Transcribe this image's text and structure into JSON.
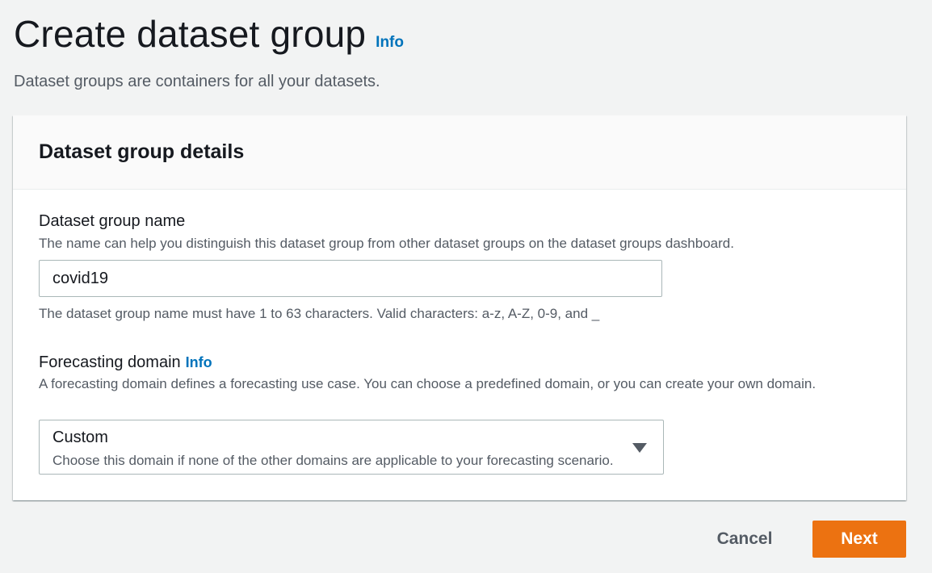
{
  "header": {
    "title": "Create dataset group",
    "info_label": "Info",
    "description": "Dataset groups are containers for all your datasets."
  },
  "panel": {
    "title": "Dataset group details",
    "name_field": {
      "label": "Dataset group name",
      "description": "The name can help you distinguish this dataset group from other dataset groups on the dataset groups dashboard.",
      "value": "covid19",
      "constraint": "The dataset group name must have 1 to 63 characters. Valid characters: a-z, A-Z, 0-9, and _"
    },
    "domain_field": {
      "label": "Forecasting domain",
      "info_label": "Info",
      "description": "A forecasting domain defines a forecasting use case. You can choose a predefined domain, or you can create your own domain.",
      "selected_value": "Custom",
      "selected_description": "Choose this domain if none of the other domains are applicable to your forecasting scenario."
    }
  },
  "actions": {
    "cancel_label": "Cancel",
    "next_label": "Next"
  },
  "colors": {
    "primary_button": "#ec7211",
    "link": "#0073bb",
    "background": "#f2f3f3"
  },
  "icons": {
    "select_caret": "caret-down-icon"
  }
}
